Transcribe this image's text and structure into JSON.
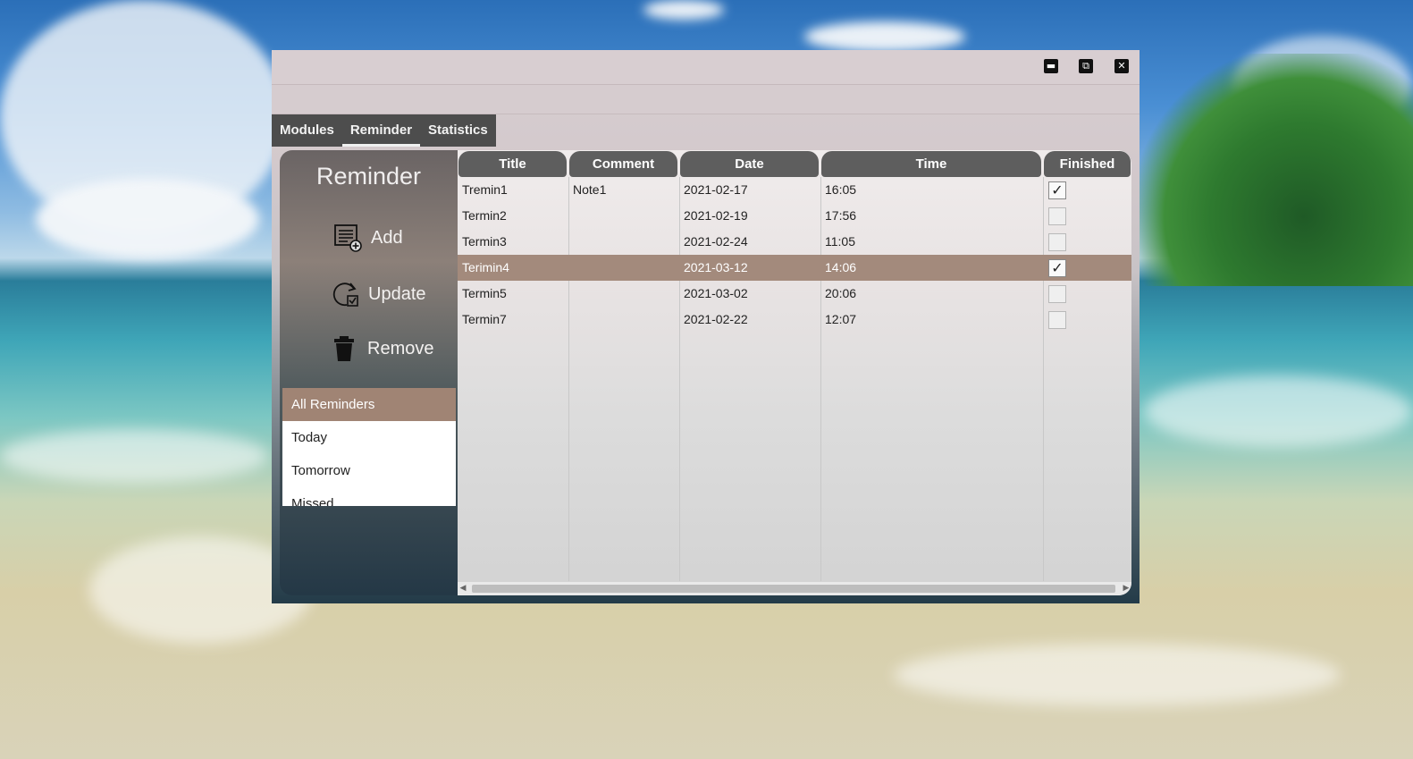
{
  "window": {
    "controls": {
      "minimize": "▬",
      "restore": "⧉",
      "close": "✕"
    }
  },
  "tabs": [
    {
      "label": "Modules"
    },
    {
      "label": "Reminder"
    },
    {
      "label": "Statistics"
    }
  ],
  "active_tab": "Reminder",
  "sidebar": {
    "title": "Reminder",
    "actions": {
      "add": "Add",
      "update": "Update",
      "remove": "Remove"
    },
    "filters": [
      "All Reminders",
      "Today",
      "Tomorrow",
      "Missed"
    ],
    "selected_filter": "All Reminders"
  },
  "table": {
    "columns": [
      "Title",
      "Comment",
      "Date",
      "Time",
      "Finished"
    ],
    "rows": [
      {
        "title": "Tremin1",
        "comment": "Note1",
        "date": "2021-02-17",
        "time": "16:05",
        "finished": true
      },
      {
        "title": "Termin2",
        "comment": "",
        "date": "2021-02-19",
        "time": "17:56",
        "finished": false
      },
      {
        "title": "Termin3",
        "comment": "",
        "date": "2021-02-24",
        "time": "11:05",
        "finished": false
      },
      {
        "title": "Terimin4",
        "comment": "",
        "date": "2021-03-12",
        "time": "14:06",
        "finished": true
      },
      {
        "title": "Termin5",
        "comment": "",
        "date": "2021-03-02",
        "time": "20:06",
        "finished": false
      },
      {
        "title": "Termin7",
        "comment": "",
        "date": "2021-02-22",
        "time": "12:07",
        "finished": false
      }
    ],
    "selected_row": 3
  },
  "colors": {
    "accent": "#a38a7c",
    "header": "#5e5e5e",
    "tab_bar": "#4d4d4d"
  },
  "icons": {
    "check": "✓",
    "scroll_left": "◀",
    "scroll_right": "▶"
  }
}
